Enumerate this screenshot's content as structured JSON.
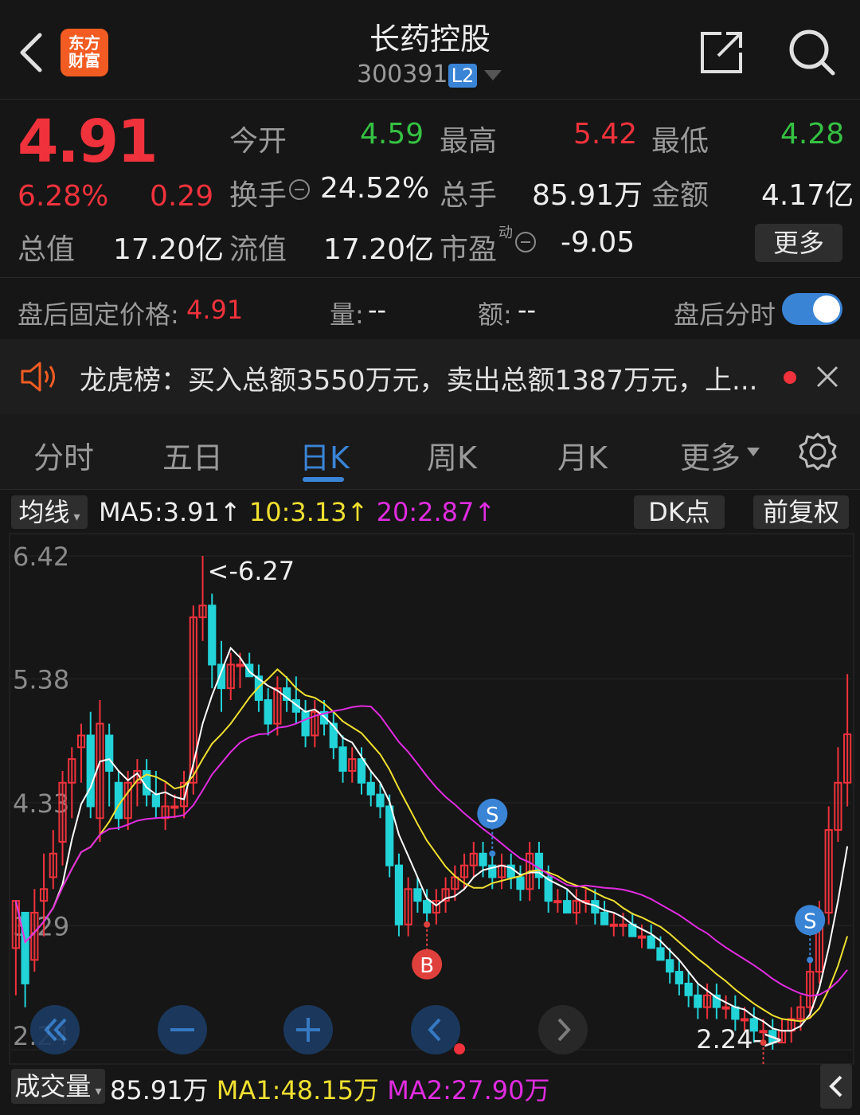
{
  "header": {
    "logo_line1": "东方",
    "logo_line2": "财富",
    "title": "长药控股",
    "code": "300391",
    "level_badge": "L2"
  },
  "quote": {
    "price": "4.91",
    "change_pct": "6.28%",
    "change": "0.29",
    "open_label": "今开",
    "open": "4.59",
    "high_label": "最高",
    "high": "5.42",
    "low_label": "最低",
    "low": "4.28",
    "turnover_label": "换手",
    "turnover": "24.52%",
    "volume_label": "总手",
    "volume": "85.91万",
    "amount_label": "金额",
    "amount": "4.17亿",
    "mktcap_label": "总值",
    "mktcap": "17.20亿",
    "float_label": "流值",
    "float_cap": "17.20亿",
    "pe_label": "市盈",
    "pe_sup": "动",
    "pe": "-9.05",
    "more_button": "更多"
  },
  "after_hours": {
    "price_label": "盘后固定价格:",
    "price": "4.91",
    "vol_label": "量:",
    "vol": "--",
    "amt_label": "额:",
    "amt": "--",
    "toggle_label": "盘后分时",
    "toggle_on": true
  },
  "news": {
    "text": "龙虎榜：买入总额3550万元，卖出总额1387万元，上..."
  },
  "tabs": [
    "分时",
    "五日",
    "日K",
    "周K",
    "月K",
    "更多"
  ],
  "active_tab": "日K",
  "chart_header": {
    "ma_select": "均线",
    "ma5": "MA5:3.91↑",
    "ma10": "10:3.13↑",
    "ma20": "20:2.87↑",
    "dk_button": "DK点",
    "adjust_button": "前复权"
  },
  "chart_labels": {
    "max_label": "<-6.27",
    "min_label": "2.24->",
    "buy_marker": "B",
    "sell_marker": "S"
  },
  "volume_row": {
    "select": "成交量",
    "vol": "85.91万",
    "ma1": "MA1:48.15万",
    "ma2": "MA2:27.90万"
  },
  "colors": {
    "up": "#f0323c",
    "down": "#22d3d8",
    "ma5": "#ffffff",
    "ma10": "#f0e030",
    "ma20": "#e02ce0",
    "accent": "#3a84d6"
  },
  "chart_data": {
    "type": "candlestick",
    "y_ticks": [
      6.42,
      5.38,
      4.33,
      3.29,
      2.24
    ],
    "ylim": [
      2.24,
      6.42
    ],
    "candles": [
      [
        3.1,
        3.5,
        2.7,
        3.5
      ],
      [
        3.4,
        3.4,
        2.6,
        2.8
      ],
      [
        3.0,
        3.6,
        2.9,
        3.4
      ],
      [
        3.5,
        3.9,
        3.2,
        3.6
      ],
      [
        3.7,
        4.1,
        3.6,
        3.9
      ],
      [
        4.0,
        4.6,
        3.8,
        4.5
      ],
      [
        4.5,
        4.8,
        4.2,
        4.7
      ],
      [
        4.8,
        5.0,
        4.5,
        4.9
      ],
      [
        4.9,
        5.1,
        4.2,
        4.3
      ],
      [
        4.2,
        5.2,
        4.0,
        5.0
      ],
      [
        4.9,
        5.0,
        4.3,
        4.6
      ],
      [
        4.5,
        4.6,
        4.1,
        4.2
      ],
      [
        4.2,
        4.6,
        4.1,
        4.5
      ],
      [
        4.5,
        4.7,
        4.3,
        4.6
      ],
      [
        4.6,
        4.7,
        4.3,
        4.4
      ],
      [
        4.4,
        4.6,
        4.2,
        4.3
      ],
      [
        4.2,
        4.5,
        4.1,
        4.3
      ],
      [
        4.3,
        4.4,
        4.2,
        4.3
      ],
      [
        4.3,
        4.6,
        4.2,
        4.5
      ],
      [
        4.5,
        6.0,
        4.4,
        5.9
      ],
      [
        5.9,
        6.42,
        5.7,
        6.0
      ],
      [
        6.0,
        6.1,
        5.3,
        5.5
      ],
      [
        5.5,
        5.7,
        5.1,
        5.3
      ],
      [
        5.3,
        5.6,
        5.2,
        5.5
      ],
      [
        5.5,
        5.6,
        5.3,
        5.5
      ],
      [
        5.5,
        5.6,
        5.4,
        5.4
      ],
      [
        5.4,
        5.5,
        5.1,
        5.2
      ],
      [
        5.2,
        5.3,
        4.9,
        5.0
      ],
      [
        5.0,
        5.4,
        4.9,
        5.3
      ],
      [
        5.3,
        5.4,
        5.1,
        5.2
      ],
      [
        5.2,
        5.4,
        5.0,
        5.1
      ],
      [
        5.1,
        5.2,
        4.8,
        4.9
      ],
      [
        4.9,
        5.2,
        4.8,
        5.1
      ],
      [
        5.1,
        5.2,
        4.9,
        5.0
      ],
      [
        5.0,
        5.1,
        4.7,
        4.8
      ],
      [
        4.8,
        4.9,
        4.5,
        4.6
      ],
      [
        4.6,
        4.8,
        4.5,
        4.7
      ],
      [
        4.7,
        4.8,
        4.4,
        4.5
      ],
      [
        4.5,
        4.6,
        4.3,
        4.4
      ],
      [
        4.4,
        4.5,
        4.2,
        4.3
      ],
      [
        4.3,
        4.4,
        3.7,
        3.8
      ],
      [
        3.8,
        3.9,
        3.2,
        3.3
      ],
      [
        3.3,
        3.7,
        3.2,
        3.6
      ],
      [
        3.6,
        3.7,
        3.4,
        3.5
      ],
      [
        3.5,
        3.6,
        3.3,
        3.4
      ],
      [
        3.4,
        3.6,
        3.3,
        3.5
      ],
      [
        3.5,
        3.7,
        3.4,
        3.6
      ],
      [
        3.6,
        3.8,
        3.5,
        3.7
      ],
      [
        3.7,
        3.9,
        3.6,
        3.8
      ],
      [
        3.8,
        4.0,
        3.7,
        3.9
      ],
      [
        3.9,
        4.0,
        3.7,
        3.8
      ],
      [
        3.8,
        3.9,
        3.6,
        3.7
      ],
      [
        3.7,
        3.9,
        3.6,
        3.8
      ],
      [
        3.8,
        3.9,
        3.6,
        3.7
      ],
      [
        3.7,
        3.8,
        3.5,
        3.6
      ],
      [
        3.6,
        4.0,
        3.5,
        3.9
      ],
      [
        3.9,
        4.0,
        3.6,
        3.7
      ],
      [
        3.7,
        3.8,
        3.4,
        3.5
      ],
      [
        3.5,
        3.6,
        3.4,
        3.5
      ],
      [
        3.5,
        3.6,
        3.4,
        3.4
      ],
      [
        3.4,
        3.6,
        3.3,
        3.5
      ],
      [
        3.5,
        3.6,
        3.4,
        3.5
      ],
      [
        3.5,
        3.6,
        3.3,
        3.4
      ],
      [
        3.4,
        3.5,
        3.3,
        3.3
      ],
      [
        3.3,
        3.4,
        3.2,
        3.3
      ],
      [
        3.3,
        3.4,
        3.2,
        3.3
      ],
      [
        3.3,
        3.4,
        3.2,
        3.2
      ],
      [
        3.2,
        3.3,
        3.1,
        3.2
      ],
      [
        3.2,
        3.3,
        3.1,
        3.1
      ],
      [
        3.1,
        3.2,
        3.0,
        3.0
      ],
      [
        3.0,
        3.1,
        2.8,
        2.9
      ],
      [
        2.9,
        3.0,
        2.7,
        2.8
      ],
      [
        2.8,
        2.9,
        2.6,
        2.7
      ],
      [
        2.7,
        2.8,
        2.5,
        2.6
      ],
      [
        2.6,
        2.8,
        2.5,
        2.7
      ],
      [
        2.7,
        2.8,
        2.5,
        2.6
      ],
      [
        2.6,
        2.7,
        2.5,
        2.6
      ],
      [
        2.6,
        2.7,
        2.4,
        2.5
      ],
      [
        2.5,
        2.6,
        2.4,
        2.5
      ],
      [
        2.5,
        2.6,
        2.3,
        2.4
      ],
      [
        2.4,
        2.5,
        2.3,
        2.4
      ],
      [
        2.4,
        2.5,
        2.24,
        2.3
      ],
      [
        2.3,
        2.5,
        2.3,
        2.4
      ],
      [
        2.4,
        2.6,
        2.3,
        2.5
      ],
      [
        2.5,
        2.7,
        2.4,
        2.6
      ],
      [
        2.6,
        3.0,
        2.5,
        2.9
      ],
      [
        2.9,
        3.5,
        2.8,
        3.4
      ],
      [
        3.4,
        4.3,
        3.3,
        4.1
      ],
      [
        4.1,
        4.8,
        4.0,
        4.5
      ],
      [
        4.5,
        5.42,
        4.3,
        4.91
      ]
    ]
  }
}
